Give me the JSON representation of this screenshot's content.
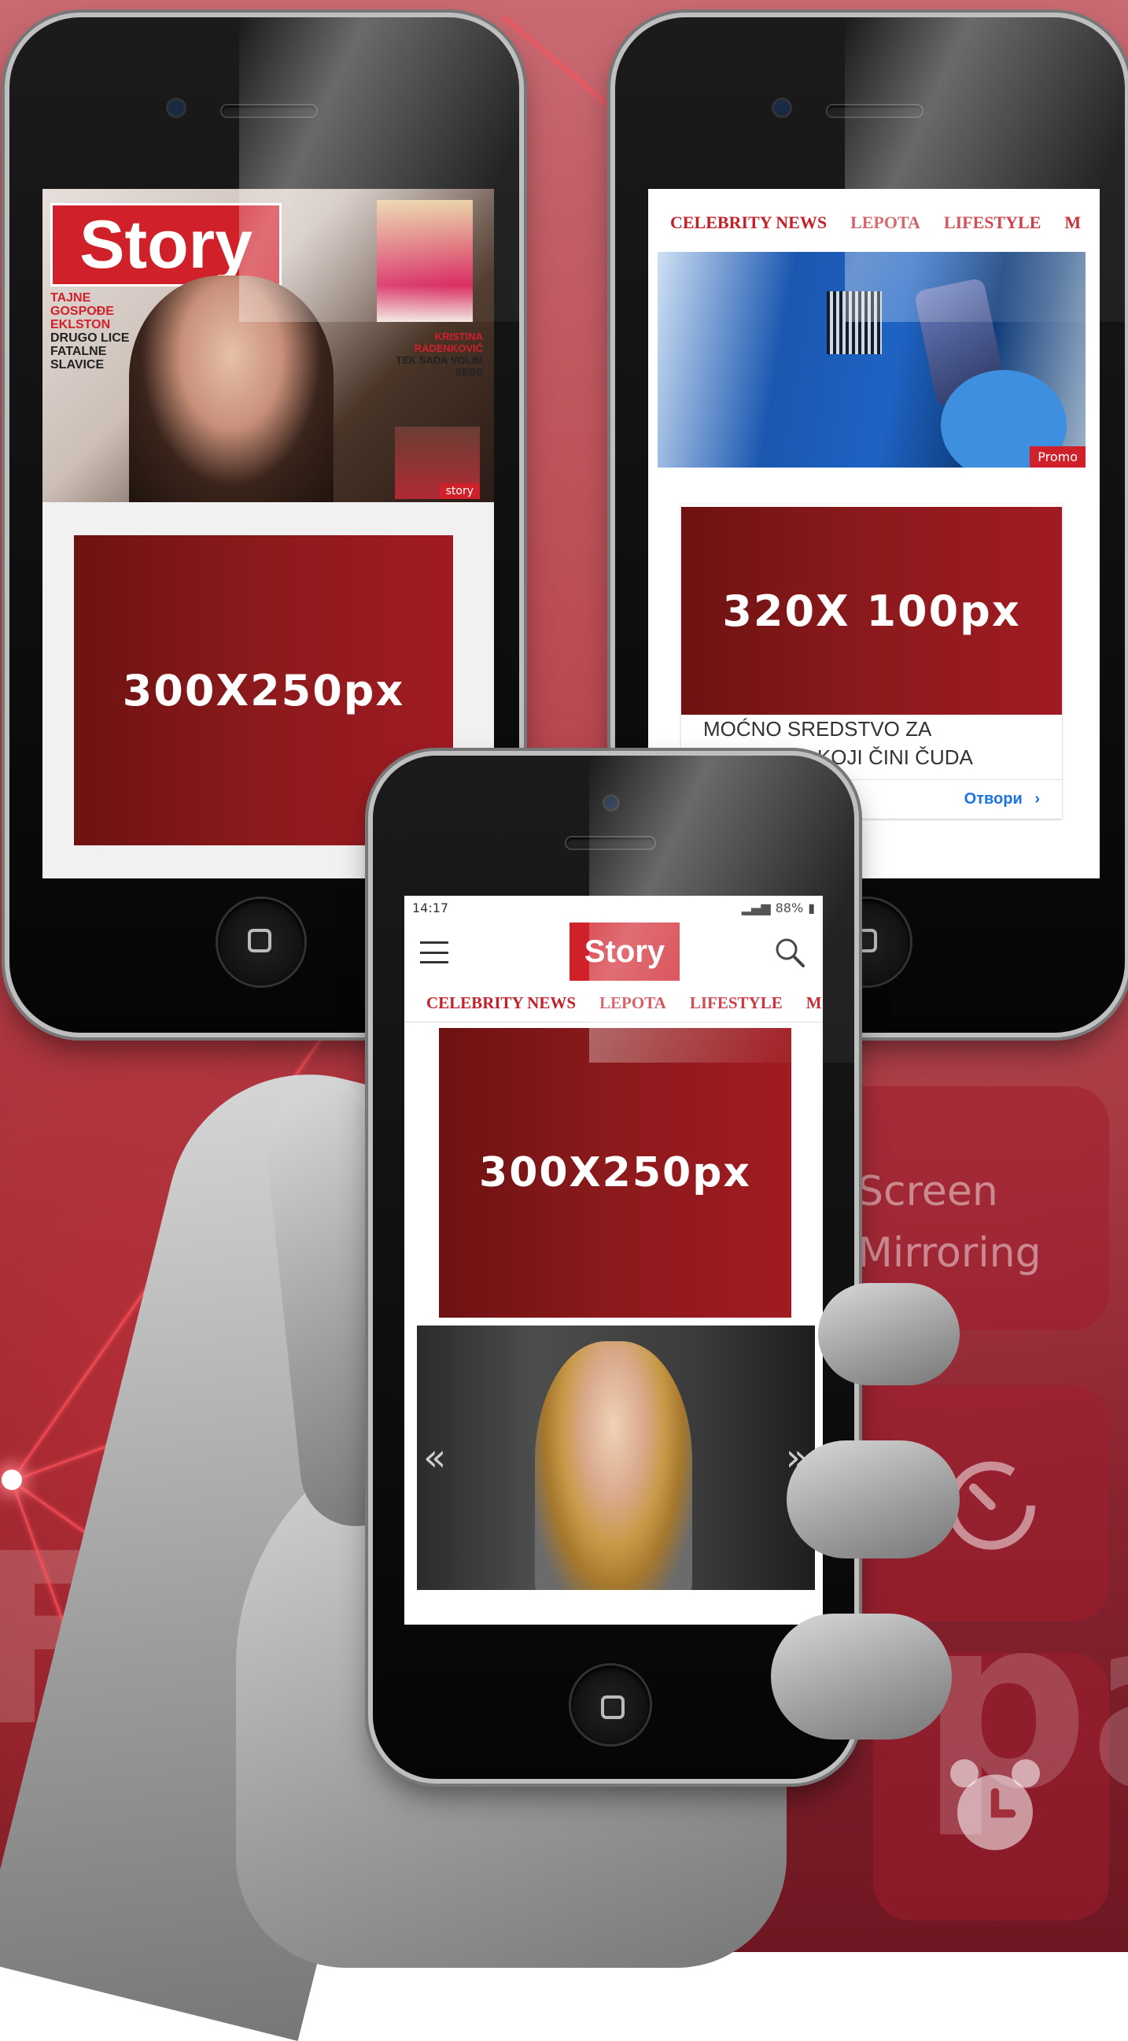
{
  "background": {
    "words": [
      "Fil",
      "pa"
    ],
    "tile_text": [
      "Screen",
      "Mirroring"
    ],
    "tile_icons": [
      "timer-icon",
      "alarm-clock-icon"
    ]
  },
  "phone_left": {
    "magazine": {
      "logo": "Story",
      "cover_lines": [
        "TAJNE",
        "GOSPOĐE",
        "EKLSTON",
        "DRUGO LICE",
        "FATALNE",
        "SLAVICE"
      ],
      "cover_name": "KRISTINA RADENKOVIĆ",
      "cover_sub": "TEK SADA VOLIM SEBE",
      "small_tag": "story"
    },
    "ad_label": "300X250px"
  },
  "phone_right": {
    "nav": [
      "CELEBRITY NEWS",
      "LEPOTA",
      "LIFESTYLE",
      "M"
    ],
    "promo_badge": "Promo",
    "ad_label": "320X 100px",
    "article_text": "MOĆNO SREDSTVO ZA PROSTATU KOJI ČINI ČUDA",
    "open_link": "Отвори"
  },
  "phone_front": {
    "status": {
      "time": "14:17",
      "battery": "88%"
    },
    "logo": "Story",
    "nav": [
      "CELEBRITY NEWS",
      "LEPOTA",
      "LIFESTYLE",
      "M"
    ],
    "ad_label": "300X250px"
  },
  "colors": {
    "brand_red": "#d0202a",
    "ad_red": "#8c1a1c",
    "link_blue": "#1a73e8"
  }
}
